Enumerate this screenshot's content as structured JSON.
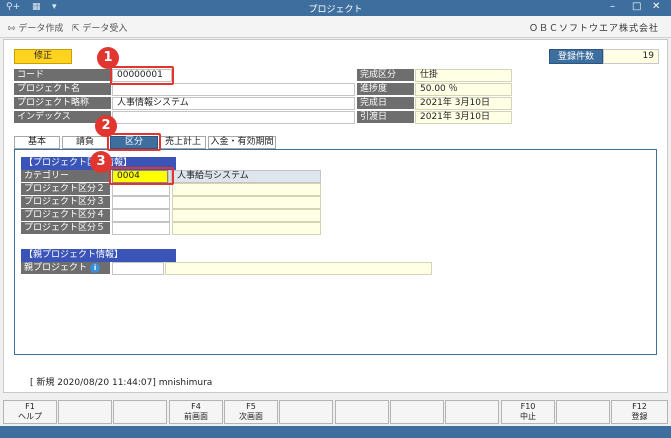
{
  "window": {
    "title": "プロジェクト"
  },
  "toolbar": {
    "export_label": "データ作成",
    "import_label": "データ受入",
    "company": "ＯＢＣソフトウエア株式会社"
  },
  "header": {
    "mode_badge": "修正",
    "count_label": "登録件数",
    "count_value": "19"
  },
  "fields": {
    "code": {
      "label": "コード",
      "value": "00000001"
    },
    "name": {
      "label": "プロジェクト名",
      "value": ""
    },
    "short_name": {
      "label": "プロジェクト略称",
      "value": "人事情報システム"
    },
    "index": {
      "label": "インデックス",
      "value": ""
    },
    "completion_type": {
      "label": "完成区分",
      "value": "仕掛"
    },
    "progress": {
      "label": "進捗度",
      "value": "50.00 ％"
    },
    "completion_date": {
      "label": "完成日",
      "value": "2021年 3月10日"
    },
    "delivery_date": {
      "label": "引渡日",
      "value": "2021年 3月10日"
    }
  },
  "tabs": [
    {
      "label": "基本"
    },
    {
      "label": "請負"
    },
    {
      "label": "区分"
    },
    {
      "label": "売上計上"
    },
    {
      "label": "入金・有効期間"
    }
  ],
  "project_section": {
    "title": "【プロジェクト区分情報】",
    "rows": [
      {
        "label": "カテゴリー",
        "code": "0004",
        "name": "人事給与システム"
      },
      {
        "label": "プロジェクト区分２",
        "code": "",
        "name": ""
      },
      {
        "label": "プロジェクト区分３",
        "code": "",
        "name": ""
      },
      {
        "label": "プロジェクト区分４",
        "code": "",
        "name": ""
      },
      {
        "label": "プロジェクト区分５",
        "code": "",
        "name": ""
      }
    ]
  },
  "parent_section": {
    "title": "【親プロジェクト情報】",
    "label": "親プロジェクト",
    "code": "",
    "name": ""
  },
  "markers": [
    "1",
    "2",
    "3"
  ],
  "status_line": "[ 新規  2020/08/20 11:44:07]  mnishimura",
  "fkeys": [
    {
      "key": "F1",
      "label": "ヘルプ"
    },
    {
      "key": "",
      "label": ""
    },
    {
      "key": "",
      "label": ""
    },
    {
      "key": "F4",
      "label": "前画面"
    },
    {
      "key": "F5",
      "label": "次画面"
    },
    {
      "key": "",
      "label": ""
    },
    {
      "key": "",
      "label": ""
    },
    {
      "key": "",
      "label": ""
    },
    {
      "key": "",
      "label": ""
    },
    {
      "key": "F10",
      "label": "中止"
    },
    {
      "key": "",
      "label": ""
    },
    {
      "key": "F12",
      "label": "登録"
    }
  ],
  "colors": {
    "accent": "#3d6e9e",
    "highlight": "#ffd320",
    "marker": "#e0362f"
  }
}
